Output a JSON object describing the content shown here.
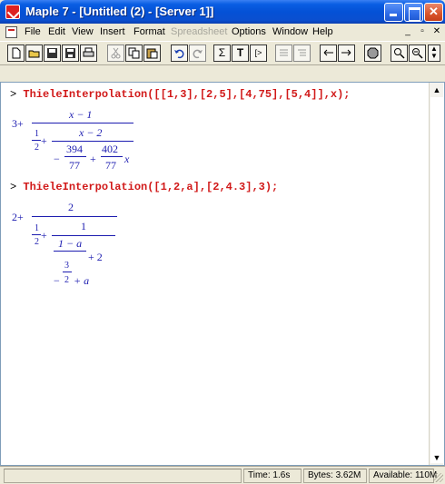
{
  "window": {
    "title": "Maple 7 - [Untitled (2) - [Server 1]]",
    "app_icon": "maple-leaf-icon"
  },
  "menu": {
    "items": [
      "File",
      "Edit",
      "View",
      "Insert",
      "Format",
      "Spreadsheet",
      "Options",
      "Window",
      "Help"
    ],
    "disabled": [
      "Spreadsheet"
    ]
  },
  "toolbar": {
    "buttons": [
      "new-icon",
      "open-icon",
      "save-icon",
      "save-all-icon",
      "print-icon",
      "cut-icon",
      "copy-icon",
      "paste-icon",
      "undo-icon",
      "redo-icon",
      "sigma-icon",
      "text-icon",
      "prompt-icon",
      "collapse-icon",
      "expand-icon",
      "left-arrow-icon",
      "right-arrow-icon",
      "stop-icon",
      "zoom-in-icon",
      "zoom-out-icon"
    ],
    "sigma": "Σ",
    "text": "T",
    "prompt": "[>"
  },
  "worksheet": {
    "prompt_symbol": ">",
    "input1": "ThieleInterpolation([[1,3],[2,5],[4,75],[5,4]],x);",
    "input2": "ThieleInterpolation([1,2,a],[2,4.3],3);",
    "out1": {
      "lead": "3+",
      "num": "x − 1",
      "half_num": "1",
      "half_den": "2",
      "plus": "+",
      "inner_num": "x − 2",
      "neg": "−",
      "c1_num": "394",
      "c1_den": "77",
      "plus2": "+",
      "c2_num": "402",
      "c2_den": "77",
      "var": "x"
    },
    "out2": {
      "top": "2",
      "lead": "2+",
      "half_num": "1",
      "half_den": "2",
      "plus": "+",
      "one": "1",
      "one_minus_a": "1 − a",
      "plus_two": "+ 2",
      "neg": "−",
      "c_num": "3",
      "c_den": "2",
      "plus_a": "+ a"
    }
  },
  "status": {
    "time_label": "Time:",
    "time_value": "1.6s",
    "bytes": "Bytes: 3.62M",
    "available": "Available: 110M"
  }
}
